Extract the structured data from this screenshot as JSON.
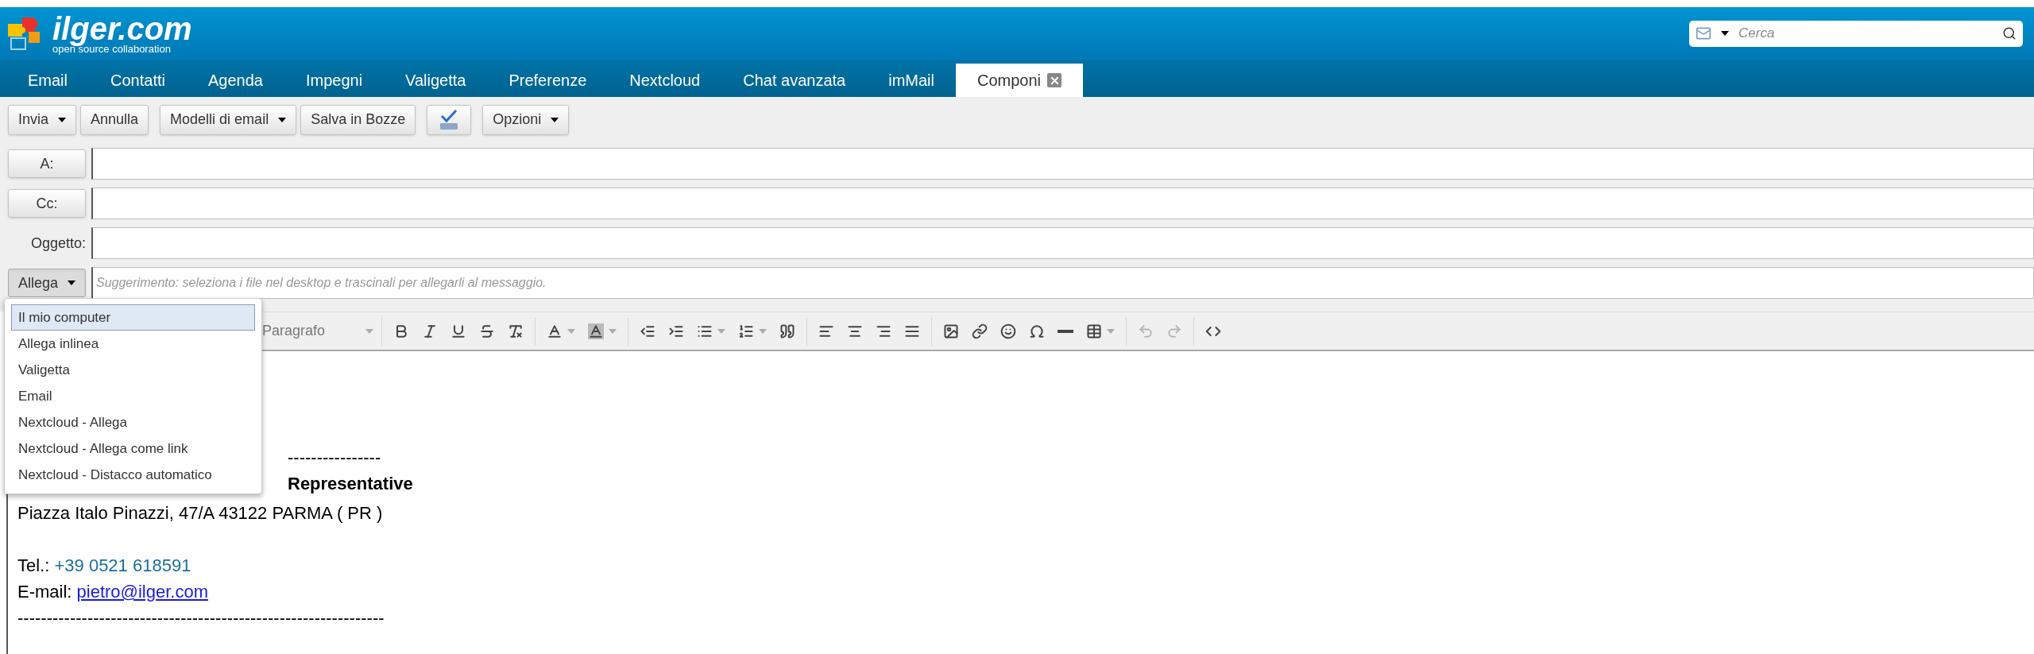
{
  "header": {
    "logo": {
      "name": "ilger.com",
      "tagline": "open source collaboration"
    },
    "search": {
      "placeholder": "Cerca"
    }
  },
  "tabs": [
    {
      "label": "Email",
      "selected": false
    },
    {
      "label": "Contatti",
      "selected": false
    },
    {
      "label": "Agenda",
      "selected": false
    },
    {
      "label": "Impegni",
      "selected": false
    },
    {
      "label": "Valigetta",
      "selected": false
    },
    {
      "label": "Preferenze",
      "selected": false
    },
    {
      "label": "Nextcloud",
      "selected": false
    },
    {
      "label": "Chat avanzata",
      "selected": false
    },
    {
      "label": "imMail",
      "selected": false
    },
    {
      "label": "Componi",
      "selected": true
    }
  ],
  "toolbar": [
    {
      "buttons": [
        {
          "kind": "text",
          "label": "Invia",
          "has_menu": true
        },
        {
          "kind": "text",
          "label": "Annulla",
          "has_menu": false
        }
      ]
    },
    {
      "buttons": [
        {
          "kind": "text",
          "label": "Modelli di email",
          "has_menu": true
        },
        {
          "kind": "text",
          "label": "Salva in Bozze",
          "has_menu": false
        }
      ]
    },
    {
      "buttons": [
        {
          "kind": "spellcheck",
          "has_menu": false
        }
      ]
    },
    {
      "buttons": [
        {
          "kind": "text",
          "label": "Opzioni",
          "has_menu": true
        }
      ]
    }
  ],
  "fields": [
    {
      "kind": "button",
      "label": "A:"
    },
    {
      "kind": "button",
      "label": "Cc:"
    },
    {
      "kind": "label",
      "label": "Oggetto:"
    },
    {
      "kind": "attach",
      "label": "Allega",
      "placeholder": "Suggerimento: seleziona i file nel desktop e trascinali per allegarli al messaggio.",
      "expanded": true
    }
  ],
  "attach_menu": [
    {
      "label": "Il mio computer",
      "selected": true
    },
    {
      "label": "Allega inlinea",
      "selected": false
    },
    {
      "label": "Valigetta",
      "selected": false
    },
    {
      "label": "Email",
      "selected": false
    },
    {
      "label": "Nextcloud - Allega",
      "selected": false
    },
    {
      "label": "Nextcloud - Allega come link",
      "selected": false
    },
    {
      "label": "Nextcloud - Distacco automatico",
      "selected": false
    }
  ],
  "format_select": {
    "value": "Paragrafo"
  },
  "editor_toolbar": [
    [
      {
        "kind": "bold",
        "has_menu": false,
        "disabled": false
      },
      {
        "kind": "italic",
        "has_menu": false,
        "disabled": false
      },
      {
        "kind": "underline",
        "has_menu": false,
        "disabled": false
      },
      {
        "kind": "strikethrough",
        "has_menu": false,
        "disabled": false
      },
      {
        "kind": "clear-format",
        "has_menu": false,
        "disabled": false
      }
    ],
    [
      {
        "kind": "text-color",
        "has_menu": true,
        "disabled": false
      },
      {
        "kind": "background-color",
        "has_menu": true,
        "disabled": false
      }
    ],
    [
      {
        "kind": "outdent",
        "has_menu": false,
        "disabled": false
      },
      {
        "kind": "indent",
        "has_menu": false,
        "disabled": false
      },
      {
        "kind": "bullet-list",
        "has_menu": true,
        "disabled": false
      },
      {
        "kind": "numbered-list",
        "has_menu": true,
        "disabled": false
      },
      {
        "kind": "quote",
        "has_menu": false,
        "disabled": false
      }
    ],
    [
      {
        "kind": "align-left",
        "has_menu": false,
        "disabled": false
      },
      {
        "kind": "align-center",
        "has_menu": false,
        "disabled": false
      },
      {
        "kind": "align-right",
        "has_menu": false,
        "disabled": false
      },
      {
        "kind": "align-justify",
        "has_menu": false,
        "disabled": false
      }
    ],
    [
      {
        "kind": "image",
        "has_menu": false,
        "disabled": false
      },
      {
        "kind": "link",
        "has_menu": false,
        "disabled": false
      },
      {
        "kind": "emoji",
        "has_menu": false,
        "disabled": false
      },
      {
        "kind": "omega",
        "has_menu": false,
        "disabled": false
      },
      {
        "kind": "horizontal-rule",
        "has_menu": false,
        "disabled": false
      },
      {
        "kind": "table",
        "has_menu": true,
        "disabled": false
      }
    ],
    [
      {
        "kind": "undo",
        "has_menu": false,
        "disabled": true
      },
      {
        "kind": "redo",
        "has_menu": false,
        "disabled": true
      }
    ],
    [
      {
        "kind": "source-code",
        "has_menu": false,
        "disabled": false
      }
    ]
  ],
  "body": [
    {
      "kind": "text",
      "indent": true,
      "parts": [
        {
          "kind": "plain",
          "text": "----------------"
        }
      ]
    },
    {
      "kind": "text",
      "indent": true,
      "parts": [
        {
          "kind": "bold",
          "text": "Representative"
        }
      ]
    },
    {
      "kind": "text",
      "indent": false,
      "parts": [
        {
          "kind": "plain",
          "text": "Piazza Italo Pinazzi, 47/A 43122 PARMA ( PR )"
        }
      ]
    },
    {
      "kind": "blank"
    },
    {
      "kind": "text",
      "indent": false,
      "parts": [
        {
          "kind": "plain",
          "text": "Tel.: "
        },
        {
          "kind": "phone",
          "text": "+39 0521 618591"
        }
      ]
    },
    {
      "kind": "text",
      "indent": false,
      "parts": [
        {
          "kind": "plain",
          "text": "E-mail: "
        },
        {
          "kind": "link",
          "text": "pietro@ilger.com"
        }
      ]
    },
    {
      "kind": "text",
      "indent": false,
      "parts": [
        {
          "kind": "plain",
          "text": "---------------------------------------------------------------"
        }
      ]
    }
  ]
}
